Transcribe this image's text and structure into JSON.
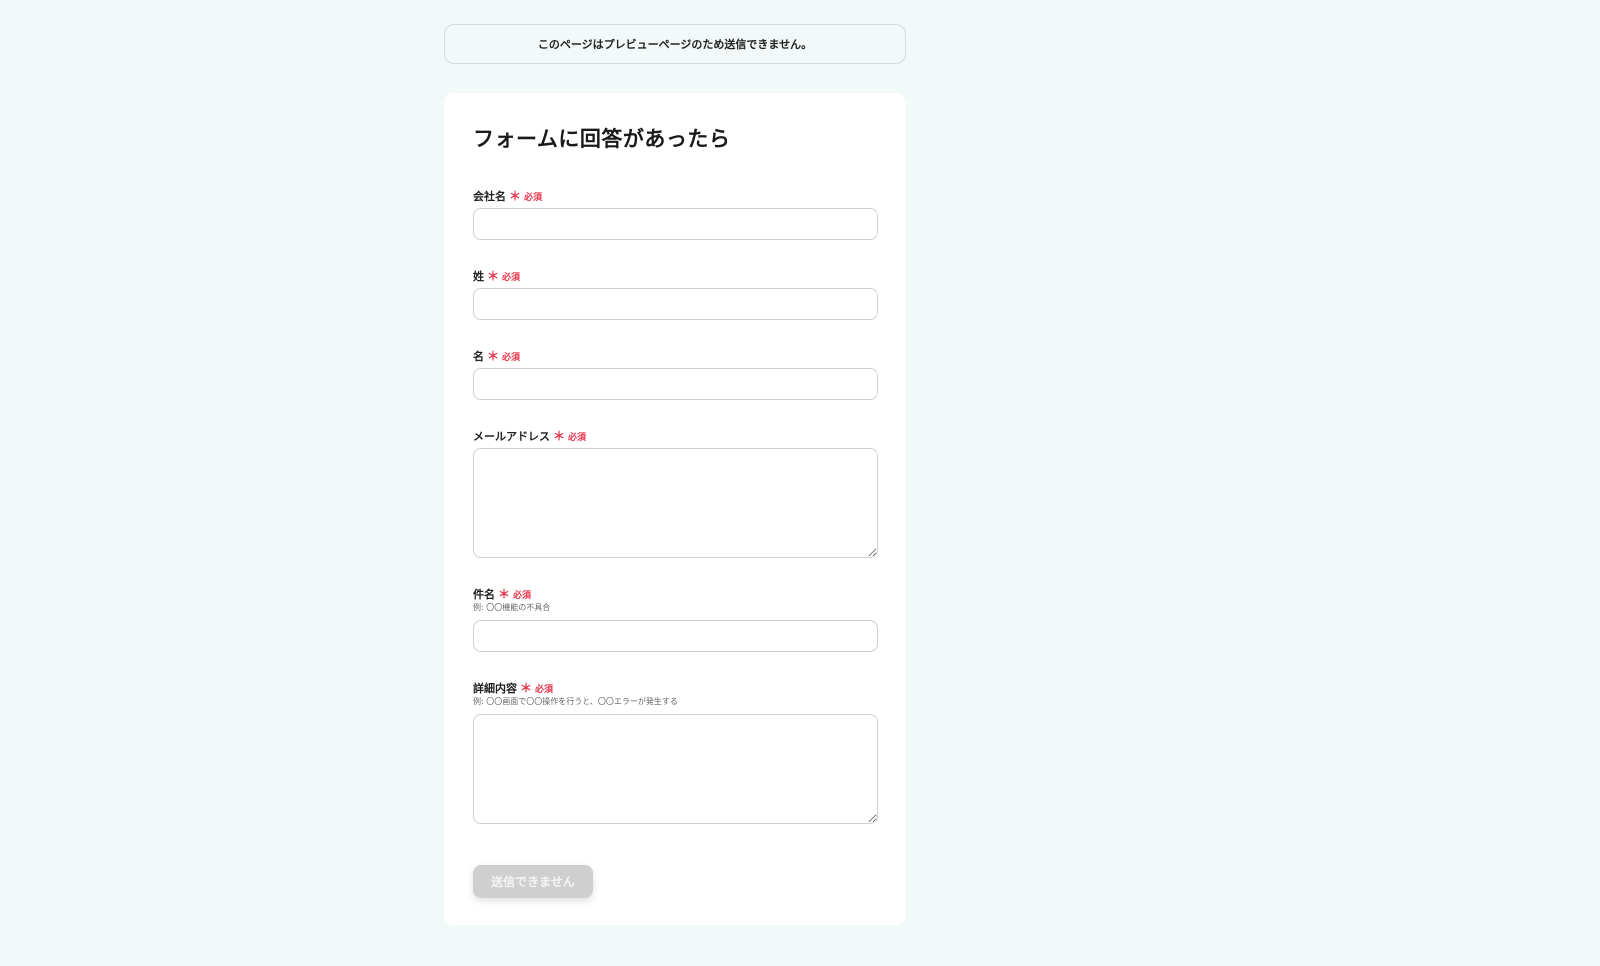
{
  "notice": {
    "text": "このページはプレビューページのため送信できません。"
  },
  "form": {
    "title": "フォームに回答があったら",
    "required_mark": "＊",
    "required_text": "必須",
    "fields": [
      {
        "label": "会社名",
        "type": "text",
        "hint": "",
        "value": ""
      },
      {
        "label": "姓",
        "type": "text",
        "hint": "",
        "value": ""
      },
      {
        "label": "名",
        "type": "text",
        "hint": "",
        "value": ""
      },
      {
        "label": "メールアドレス",
        "type": "textarea",
        "hint": "",
        "value": ""
      },
      {
        "label": "件名",
        "type": "text",
        "hint": "例: 〇〇機能の不具合",
        "value": ""
      },
      {
        "label": "詳細内容",
        "type": "textarea",
        "hint": "例: 〇〇画面で〇〇操作を行うと、〇〇エラーが発生する",
        "value": ""
      }
    ],
    "submit_label": "送信できません"
  },
  "colors": {
    "background": "#f1faf8",
    "required": "#e8334a",
    "submit_disabled": "#cfcfcf"
  }
}
